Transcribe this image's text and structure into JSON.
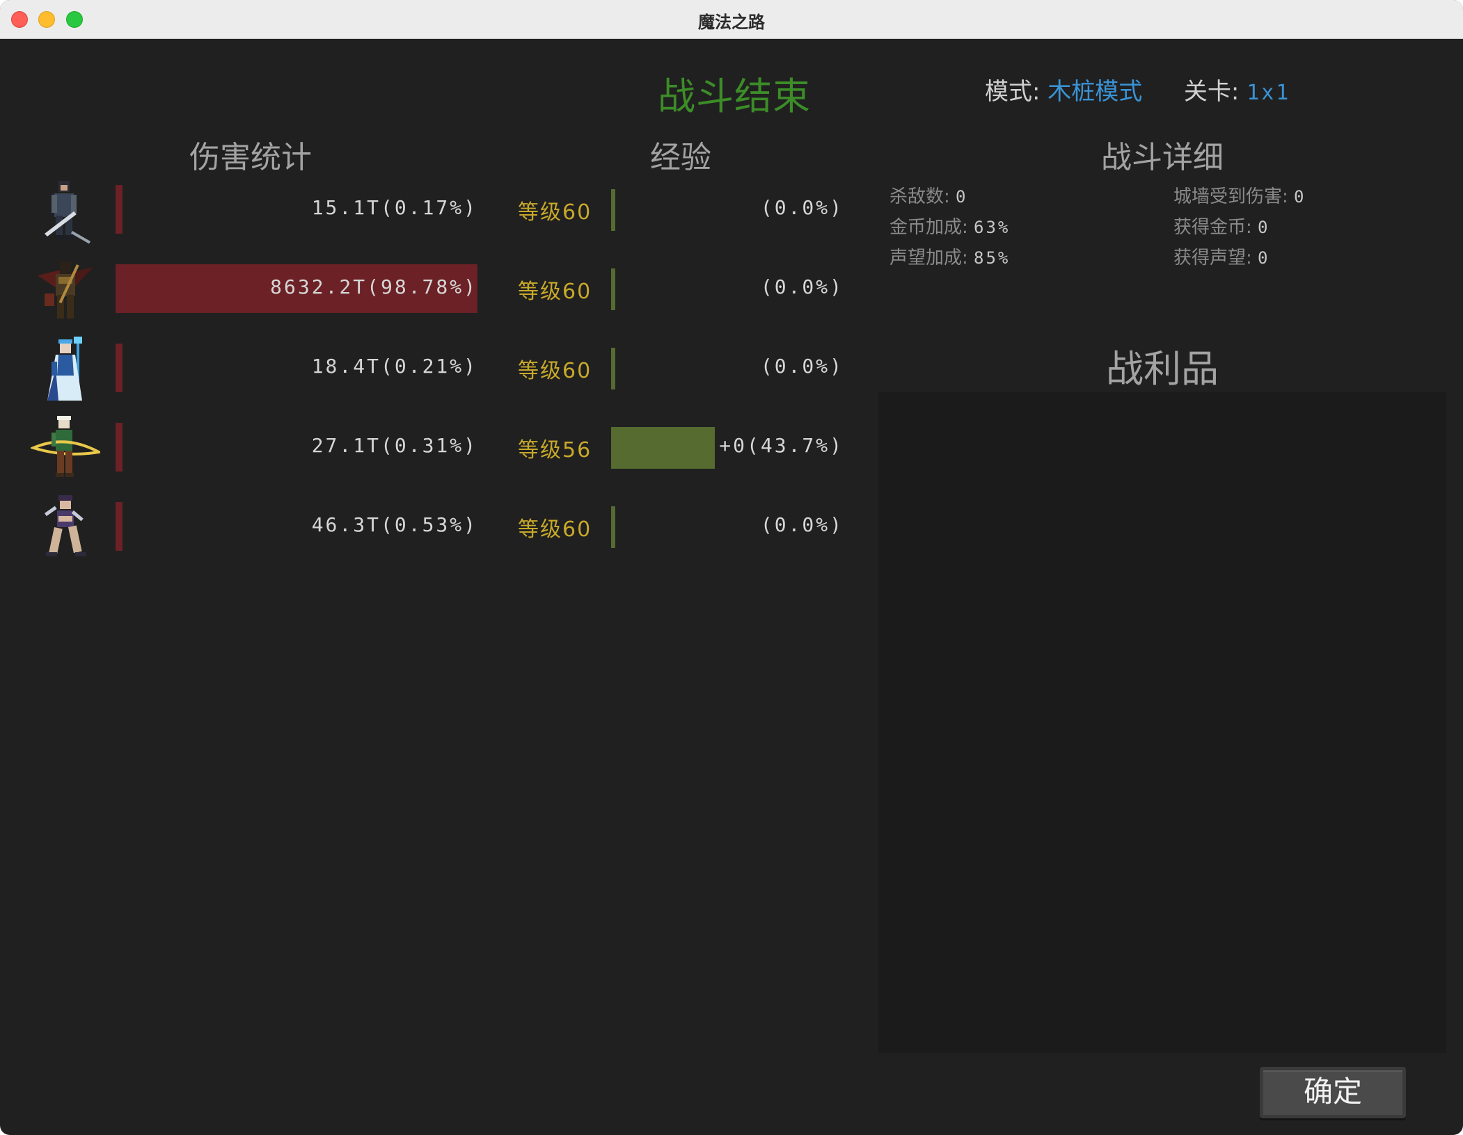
{
  "window": {
    "title": "魔法之路"
  },
  "header": {
    "battle_title": "战斗结束",
    "mode_label": "模式:",
    "mode_value": "木桩模式",
    "stage_label": "关卡:",
    "stage_value": "1x1"
  },
  "sections": {
    "damage": "伤害统计",
    "exp": "经验",
    "detail": "战斗详细",
    "loot": "战利品"
  },
  "heroes": [
    {
      "name": "warrior-portrait",
      "damage_text": "15.1T(0.17%)",
      "damage_pct": 0.17,
      "level_text": "等级60",
      "exp_text": "(0.0%)",
      "exp_pct": 0.0
    },
    {
      "name": "dark-knight-portrait",
      "damage_text": "8632.2T(98.78%)",
      "damage_pct": 98.78,
      "level_text": "等级60",
      "exp_text": "(0.0%)",
      "exp_pct": 0.0
    },
    {
      "name": "ice-mage-portrait",
      "damage_text": "18.4T(0.21%)",
      "damage_pct": 0.21,
      "level_text": "等级60",
      "exp_text": "(0.0%)",
      "exp_pct": 0.0
    },
    {
      "name": "elf-archer-portrait",
      "damage_text": "27.1T(0.31%)",
      "damage_pct": 0.31,
      "level_text": "等级56",
      "exp_text": "+0(43.7%)",
      "exp_pct": 43.7
    },
    {
      "name": "blade-dancer-portrait",
      "damage_text": "46.3T(0.53%)",
      "damage_pct": 0.53,
      "level_text": "等级60",
      "exp_text": "(0.0%)",
      "exp_pct": 0.0
    }
  ],
  "details": {
    "kills_label": "杀敌数:",
    "kills_value": "0",
    "wall_damage_label": "城墙受到伤害:",
    "wall_damage_value": "0",
    "gold_bonus_label": "金币加成:",
    "gold_bonus_value": "63%",
    "gold_gain_label": "获得金币:",
    "gold_gain_value": "0",
    "fame_bonus_label": "声望加成:",
    "fame_bonus_value": "85%",
    "fame_gain_label": "获得声望:",
    "fame_gain_value": "0"
  },
  "buttons": {
    "confirm": "确定"
  },
  "colors": {
    "background": "#202020",
    "damage_bar": "#6b2126",
    "exp_bar": "#556b2f",
    "title_green": "#3c8c28",
    "level_gold": "#c8a92a",
    "link_blue": "#3a93d6"
  }
}
